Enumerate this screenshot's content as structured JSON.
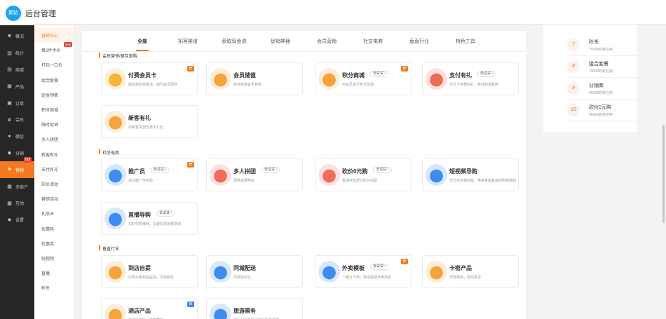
{
  "header": {
    "logo_text": "聚贴",
    "title": "后台管理"
  },
  "sidebar": {
    "items": [
      {
        "icon": "■",
        "icon_name": "overview-icon",
        "label": "概况"
      },
      {
        "icon": "▥",
        "icon_name": "stats-icon",
        "label": "统计"
      },
      {
        "icon": "▤",
        "icon_name": "store-icon",
        "label": "商城"
      },
      {
        "icon": "▦",
        "icon_name": "product-icon",
        "label": "产品"
      },
      {
        "icon": "▣",
        "icon_name": "order-icon",
        "label": "订单"
      },
      {
        "icon": "♛",
        "icon_name": "member-icon",
        "label": "会员"
      },
      {
        "icon": "●",
        "icon_name": "wechat-icon",
        "label": "微信"
      },
      {
        "icon": "◆",
        "icon_name": "distribution-icon",
        "label": "分销"
      },
      {
        "icon": "⚑",
        "icon_name": "flag-icon",
        "label": "营销",
        "active": true,
        "badge": "hot"
      },
      {
        "icon": "▦",
        "icon_name": "multi-store-icon",
        "label": "多商户"
      },
      {
        "icon": "▩",
        "icon_name": "interact-icon",
        "label": "互动"
      },
      {
        "icon": "✹",
        "icon_name": "settings-icon",
        "label": "设置"
      }
    ]
  },
  "submenu": {
    "items": [
      {
        "label": "营销中心",
        "active": true
      },
      {
        "label": "第2件半价",
        "badge": "new"
      },
      {
        "label": "打包一口价"
      },
      {
        "label": "组合套餐"
      },
      {
        "label": "定金预售"
      },
      {
        "label": "积分商城"
      },
      {
        "label": "限时促销"
      },
      {
        "label": "多人拼团"
      },
      {
        "label": "新客有礼"
      },
      {
        "label": "支付有礼"
      },
      {
        "label": "砍价活动"
      },
      {
        "label": "营销活动"
      },
      {
        "label": "礼品卡"
      },
      {
        "label": "优惠码"
      },
      {
        "label": "优惠券"
      },
      {
        "label": "短视频"
      },
      {
        "label": "直播"
      },
      {
        "label": "秒杀"
      }
    ]
  },
  "tabs": [
    "全部",
    "拓客渠道",
    "获取现金流",
    "促销神器",
    "会员营销",
    "社交电商",
    "垂直行业",
    "特色工具"
  ],
  "sections": [
    {
      "title": "会员营销/留存复购",
      "cards": [
        {
          "title": "付费会员卡",
          "desc": "提前获取现金流，提升会员留存",
          "icon_name": "vip-card-icon",
          "icon_color": "#f6b43c",
          "corner": "荐"
        },
        {
          "title": "会员储值",
          "desc": "有效刺激会员复购",
          "icon_name": "recharge-icon",
          "icon_color": "#f5a43c"
        },
        {
          "title": "积分商城",
          "desc": "对会员进行积分营销",
          "trial": "去试试",
          "icon_name": "points-mall-icon",
          "icon_color": "#f5a23a",
          "corner": "荐"
        },
        {
          "title": "支付有礼",
          "desc": "支付下单赠好礼，有效刺激复购",
          "trial": "去试试",
          "icon_name": "pay-gift-icon",
          "icon_color": "#f06a5b"
        },
        {
          "title": "新客有礼",
          "desc": "向新客发放优惠大礼包",
          "icon_name": "new-customer-gift-icon",
          "icon_color": "#f5a43c"
        }
      ]
    },
    {
      "title": "社交电商",
      "cards": [
        {
          "title": "推广员",
          "desc": "成功推广传奖励",
          "trial": "去试试",
          "icon_name": "promoter-icon",
          "icon_color": "#3f8cf0",
          "corner": "荐"
        },
        {
          "title": "多人拼团",
          "desc": "团满送惠购买",
          "trial": "去试试",
          "icon_name": "group-buy-icon",
          "icon_color": "#f26c5c"
        },
        {
          "title": "砍价0元购",
          "desc": "邀请好友帮忙砍价商品",
          "trial": "去试试",
          "icon_name": "bargain-icon",
          "icon_color": "#f26c5c"
        },
        {
          "title": "短视频导购",
          "desc": "全方位包装商品，带来身临其境的购物体验",
          "icon_name": "short-video-icon",
          "icon_color": "#3f8cf0"
        },
        {
          "title": "直播导购",
          "desc": "实时导购推荐，快速实现流量变现",
          "trial": "去试试",
          "icon_name": "live-shopping-icon",
          "icon_color": "#3f8cf0"
        }
      ]
    },
    {
      "title": "垂直行业",
      "cards": [
        {
          "title": "到店自提",
          "desc": "引导买家到店提货，享受服务",
          "icon_name": "store-pickup-icon",
          "icon_color": "#f5a43c"
        },
        {
          "title": "同城配送",
          "desc": "同城及时达",
          "icon_name": "city-delivery-icon",
          "icon_color": "#3f8cf0"
        },
        {
          "title": "外卖模板",
          "desc": "一键行下单，极速搭建外卖商城",
          "trial": "去试试",
          "icon_name": "takeout-icon",
          "icon_color": "#3f8cf0",
          "corner": "荐"
        },
        {
          "title": "卡密产品",
          "desc": "无需物流，自动发货",
          "icon_name": "card-key-icon",
          "icon_color": "#f5a43c"
        },
        {
          "title": "酒店产品",
          "desc": "助力酒店行业精准营销",
          "icon_name": "hotel-icon",
          "icon_color": "#f5a43c",
          "corner": "新"
        },
        {
          "title": "旅游票务",
          "desc": "旅行门票景区门票行程和票务",
          "icon_name": "travel-ticket-icon",
          "icon_color": "#3f8cf0"
        }
      ]
    }
  ],
  "right_panel": {
    "items": [
      {
        "rank": "7",
        "name": "秒杀",
        "count": "75593商家在用"
      },
      {
        "rank": "8",
        "name": "组合套餐",
        "count": "70093商家在用"
      },
      {
        "rank": "9",
        "name": "分销商",
        "count": "69908商家在用"
      },
      {
        "rank": "10",
        "name": "砍价0元购",
        "count": "66690商家在用"
      }
    ]
  },
  "colors": {
    "accent": "#f5791f",
    "sidebar_bg": "#262626",
    "hot_badge": "#e9433f",
    "blue_badge": "#3f7ff0"
  }
}
